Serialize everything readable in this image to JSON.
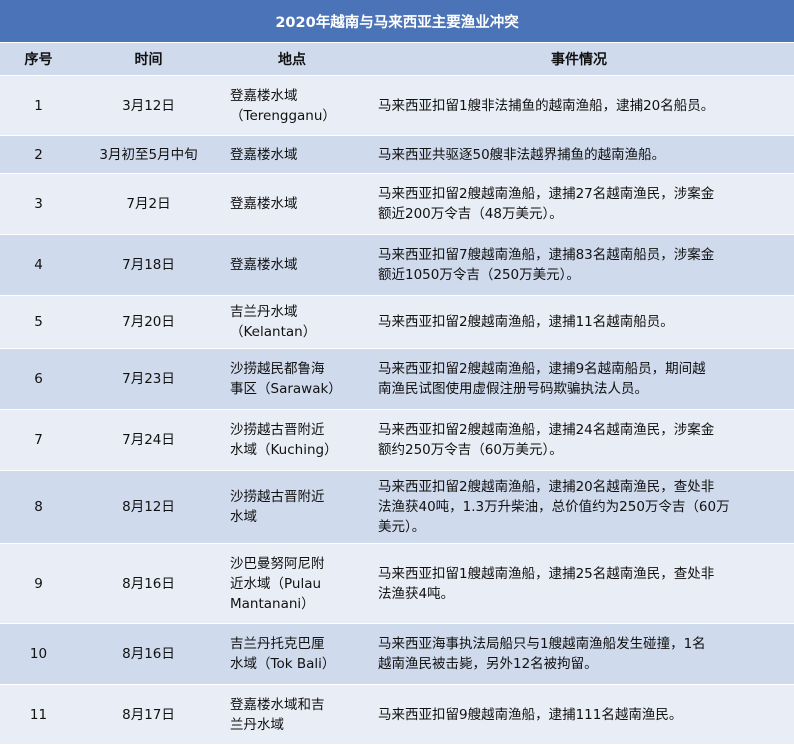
{
  "title": "2020年越南与马来西亚主要渔业冲突",
  "headers": {
    "num": "序号",
    "date": "时间",
    "place": "地点",
    "event": "事件情况"
  },
  "rows": [
    {
      "num": "1",
      "date": "3月12日",
      "place": [
        "登嘉楼水域",
        "（Terengganu）"
      ],
      "event": [
        "马来西亚扣留1艘非法捕鱼的越南渔船，逮捕20名船员。"
      ]
    },
    {
      "num": "2",
      "date": "3月初至5月中旬",
      "place": [
        "登嘉楼水域"
      ],
      "event": [
        "马来西亚共驱逐50艘非法越界捕鱼的越南渔船。"
      ]
    },
    {
      "num": "3",
      "date": "7月2日",
      "place": [
        "登嘉楼水域"
      ],
      "event": [
        "马来西亚扣留2艘越南渔船，逮捕27名越南渔民，涉案金",
        "额近200万令吉（48万美元）。"
      ]
    },
    {
      "num": "4",
      "date": "7月18日",
      "place": [
        "登嘉楼水域"
      ],
      "event": [
        "马来西亚扣留7艘越南渔船，逮捕83名越南船员，涉案金",
        "额近1050万令吉（250万美元）。"
      ]
    },
    {
      "num": "5",
      "date": "7月20日",
      "place": [
        "吉兰丹水域",
        "（Kelantan）"
      ],
      "event": [
        "马来西亚扣留2艘越南渔船，逮捕11名越南船员。"
      ]
    },
    {
      "num": "6",
      "date": "7月23日",
      "place": [
        "沙捞越民都鲁海",
        "事区（Sarawak）"
      ],
      "event": [
        "马来西亚扣留2艘越南渔船，逮捕9名越南船员，期间越",
        "南渔民试图使用虚假注册号码欺骗执法人员。"
      ]
    },
    {
      "num": "7",
      "date": "7月24日",
      "place": [
        "沙捞越古晋附近",
        "水域（Kuching）"
      ],
      "event": [
        "马来西亚扣留2艘越南渔船，逮捕24名越南渔民，涉案金",
        "额约250万令吉（60万美元）。"
      ]
    },
    {
      "num": "8",
      "date": "8月12日",
      "place": [
        "沙捞越古晋附近",
        "水域"
      ],
      "event": [
        "马来西亚扣留2艘越南渔船，逮捕20名越南渔民，查处非",
        "法渔获40吨，1.3万升柴油，总价值约为250万令吉（60万",
        "美元）。"
      ]
    },
    {
      "num": "9",
      "date": "8月16日",
      "place": [
        "沙巴曼努阿尼附",
        "近水域（Pulau",
        "Mantanani）"
      ],
      "event": [
        "马来西亚扣留1艘越南渔船，逮捕25名越南渔民，查处非",
        "法渔获4吨。"
      ]
    },
    {
      "num": "10",
      "date": "8月16日",
      "place": [
        "吉兰丹托克巴厘",
        "水域（Tok Bali）"
      ],
      "event": [
        "马来西亚海事执法局船只与1艘越南渔船发生碰撞，1名",
        "越南渔民被击毙，另外12名被拘留。"
      ]
    },
    {
      "num": "11",
      "date": "8月17日",
      "place": [
        "登嘉楼水域和吉",
        "兰丹水域"
      ],
      "event": [
        "马来西亚扣留9艘越南渔船，逮捕111名越南渔民。"
      ]
    }
  ]
}
